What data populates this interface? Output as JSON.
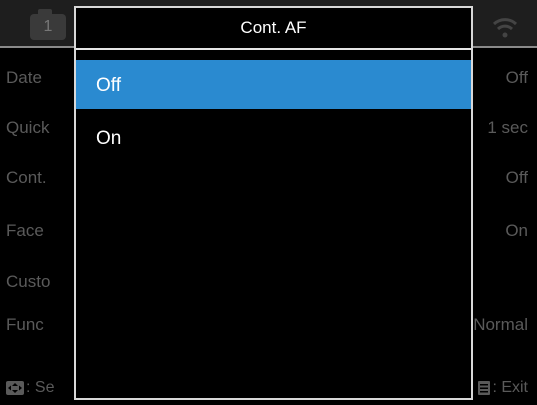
{
  "background_menu": {
    "rows": [
      {
        "label": "Date",
        "value": "Off"
      },
      {
        "label": "Quick",
        "value": "1 sec"
      },
      {
        "label": "Cont.",
        "value": "Off"
      },
      {
        "label": "Face",
        "value": "On"
      },
      {
        "label": "Custo",
        "value": ""
      },
      {
        "label": "Func",
        "value": "Normal"
      }
    ],
    "tab_number": "1",
    "footer": {
      "left_label": ": Se",
      "right_label": ": Exit"
    }
  },
  "popup": {
    "title": "Cont. AF",
    "options": [
      {
        "label": "Off",
        "selected": true
      },
      {
        "label": "On",
        "selected": false
      }
    ]
  },
  "colors": {
    "selection": "#2a8ad0",
    "background": "#000000",
    "dimmed_text": "#5a5a5a"
  },
  "icons": {
    "camera_tab": "camera-icon",
    "wifi": "wifi-icon",
    "dpad": "dpad-icon",
    "menu": "menu-icon"
  }
}
